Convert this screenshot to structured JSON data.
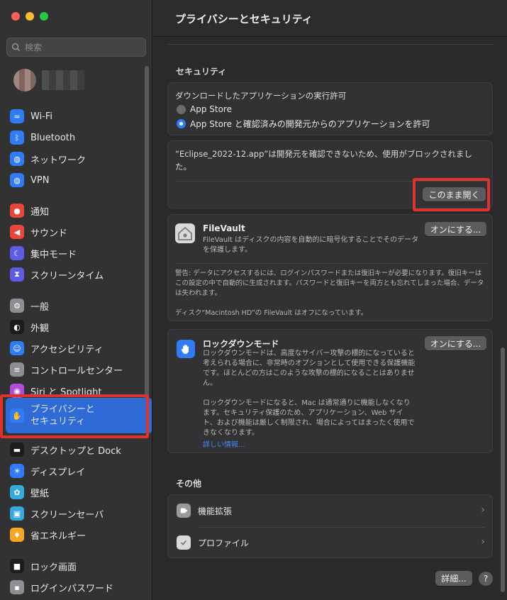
{
  "window": {
    "title": "プライバシーとセキュリティ"
  },
  "search": {
    "placeholder": "検索"
  },
  "sidebar": {
    "items": [
      {
        "label": "Wi-Fi",
        "icon": "wifi-icon",
        "color": "#2f7cf6"
      },
      {
        "label": "Bluetooth",
        "icon": "bluetooth-icon",
        "color": "#2f7cf6"
      },
      {
        "label": "ネットワーク",
        "icon": "globe-icon",
        "color": "#2f7cf6"
      },
      {
        "label": "VPN",
        "icon": "globe-icon",
        "color": "#2f7cf6"
      },
      {
        "label": "通知",
        "icon": "bell-icon",
        "color": "#e8453c"
      },
      {
        "label": "サウンド",
        "icon": "speaker-icon",
        "color": "#e8453c"
      },
      {
        "label": "集中モード",
        "icon": "moon-icon",
        "color": "#5e5ce6"
      },
      {
        "label": "スクリーンタイム",
        "icon": "hourglass-icon",
        "color": "#5e5ce6"
      },
      {
        "label": "一般",
        "icon": "gear-icon",
        "color": "#8e8e93"
      },
      {
        "label": "外観",
        "icon": "appearance-icon",
        "color": "#1c1c1e"
      },
      {
        "label": "アクセシビリティ",
        "icon": "accessibility-icon",
        "color": "#2f7cf6"
      },
      {
        "label": "コントロールセンター",
        "icon": "toggles-icon",
        "color": "#8e8e93"
      },
      {
        "label": "Siri と Spotlight",
        "icon": "siri-icon",
        "color": "#b04fd6"
      },
      {
        "label": "プライバシーと\nセキュリティ",
        "icon": "hand-icon",
        "color": "#2f7cf6"
      },
      {
        "label": "デスクトップと Dock",
        "icon": "dock-icon",
        "color": "#1c1c1e"
      },
      {
        "label": "ディスプレイ",
        "icon": "sun-icon",
        "color": "#2f7cf6"
      },
      {
        "label": "壁紙",
        "icon": "flower-icon",
        "color": "#34aadc"
      },
      {
        "label": "スクリーンセーバ",
        "icon": "screensaver-icon",
        "color": "#34aadc"
      },
      {
        "label": "省エネルギー",
        "icon": "bulb-icon",
        "color": "#f5a623"
      },
      {
        "label": "ロック画面",
        "icon": "lock-icon",
        "color": "#1c1c1e"
      },
      {
        "label": "ログインパスワード",
        "icon": "key-icon",
        "color": "#8e8e93"
      }
    ]
  },
  "security": {
    "heading": "セキュリティ",
    "download_title": "ダウンロードしたアプリケーションの実行許可",
    "options": [
      "App Store",
      "App Store と確認済みの開発元からのアプリケーションを許可"
    ],
    "selected_option": 1,
    "blocked_message": "“Eclipse_2022-12.app”は開発元を確認できないため、使用がブロックされました。",
    "open_anyway": "このまま開く"
  },
  "filevault": {
    "title": "FileVault",
    "description": "FileVault はディスクの内容を自動的に暗号化することでそのデータを保護します。",
    "button": "オンにする...",
    "warning": "警告: データにアクセスするには、ログインパスワードまたは復旧キーが必要になります。復旧キーはこの設定の中で自動的に生成されます。パスワードと復旧キーを両方とも忘れてしまった場合、データは失われます。",
    "status": "ディスク“Macintosh HD”の FileVault はオフになっています。"
  },
  "lockdown": {
    "title": "ロックダウンモード",
    "button": "オンにする...",
    "description1": "ロックダウンモードは、高度なサイバー攻撃の標的になっていると考えられる場合に、非常時のオプションとして使用できる保護機能です。ほとんどの方はこのような攻撃の標的になることはありません。",
    "description2": "ロックダウンモードになると、Mac は通常通りに機能しなくなります。セキュリティ保護のため、アプリケーション、Web サイト、および機能は厳しく制限され、場合によってはまったく使用できなくなります。",
    "link": "詳しい情報..."
  },
  "other": {
    "heading": "その他",
    "rows": [
      "機能拡張",
      "プロファイル"
    ]
  },
  "footer": {
    "advanced": "詳細...",
    "help": "?"
  }
}
